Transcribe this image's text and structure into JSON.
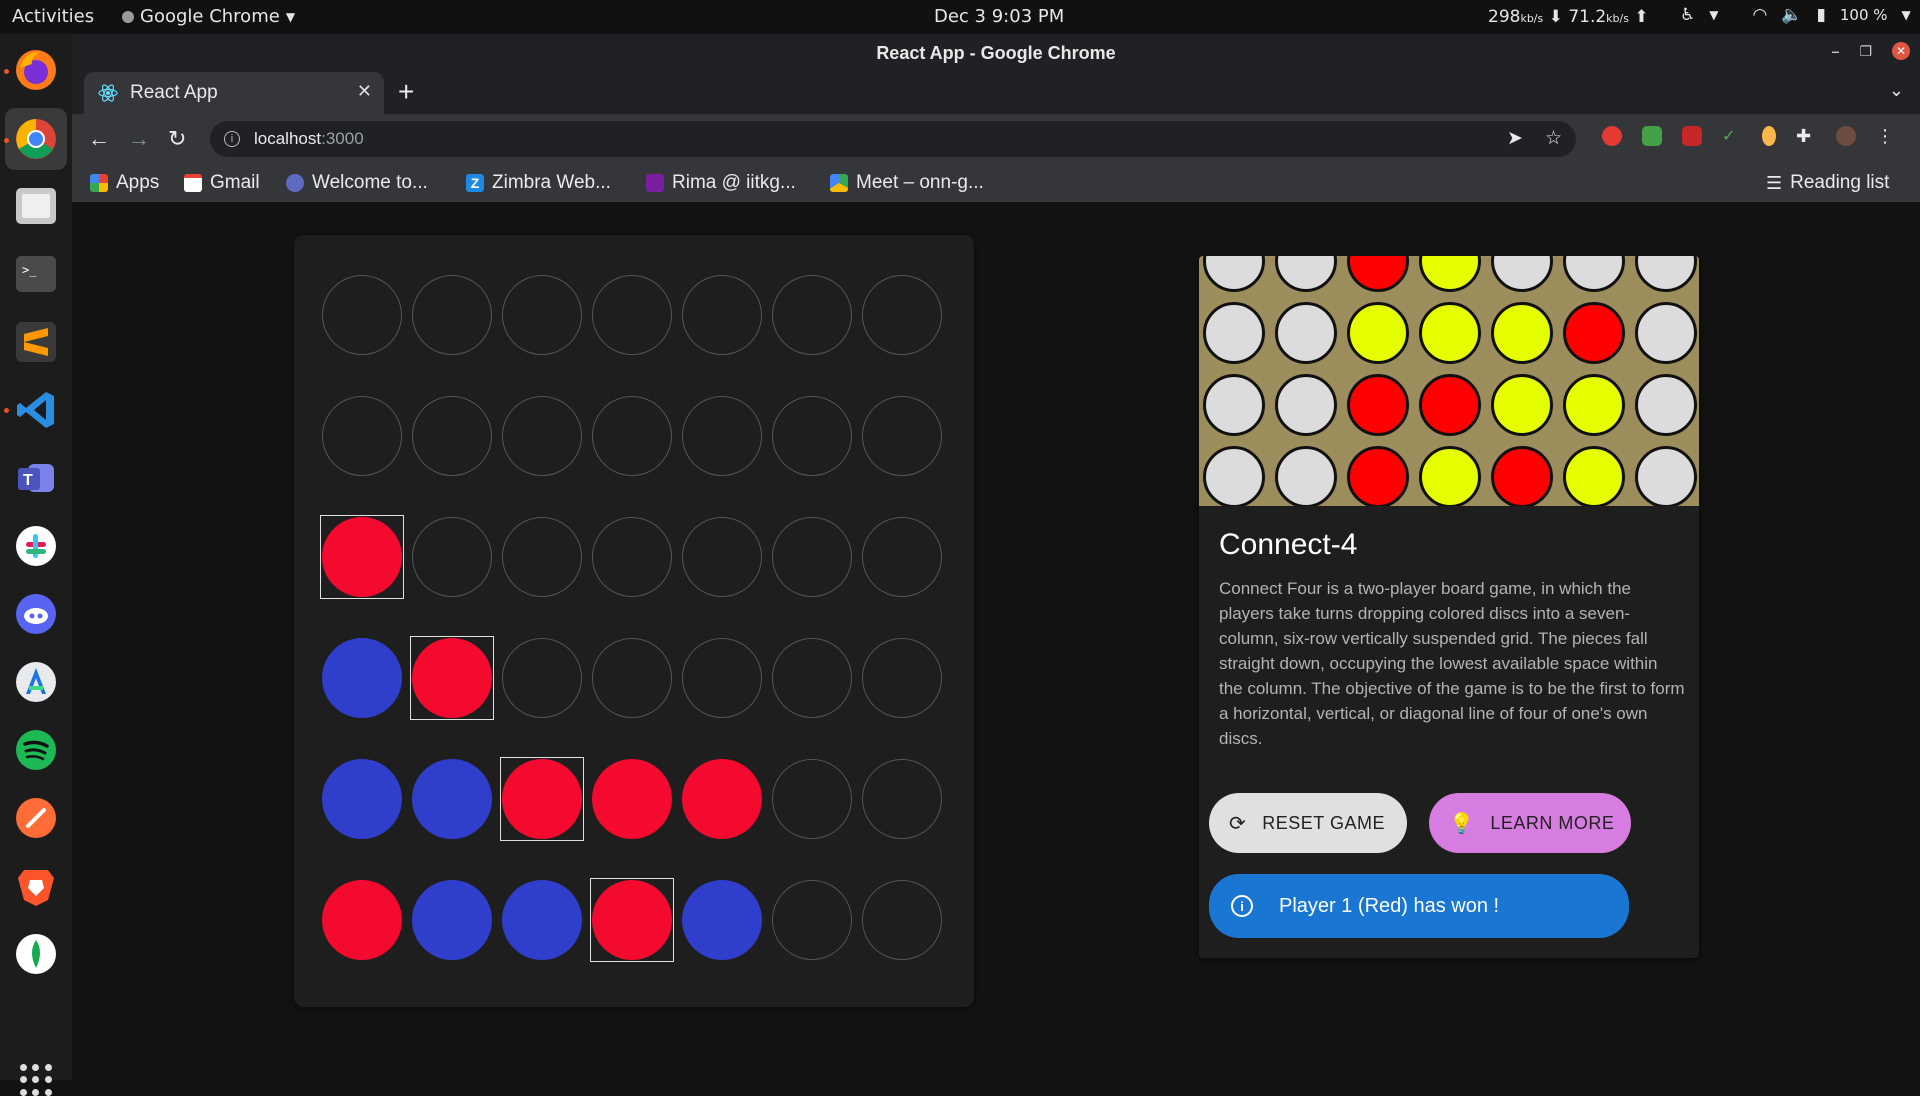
{
  "topbar": {
    "activities": "Activities",
    "app_name": "Google Chrome",
    "clock": "Dec 3  9:03 PM",
    "net_down": "298",
    "net_up": "71.2",
    "net_unit": "kb/s",
    "battery": "100 %"
  },
  "dock": {
    "items": [
      "Firefox",
      "Google Chrome",
      "Files",
      "Terminal",
      "Sublime Text",
      "Visual Studio Code",
      "Microsoft Teams",
      "Slack",
      "Discord",
      "Android Studio",
      "Spotify",
      "Postman",
      "Brave",
      "MongoDB Compass"
    ]
  },
  "window": {
    "title": "React App - Google Chrome"
  },
  "tab": {
    "title": "React App",
    "new_tab": "+"
  },
  "omnibox": {
    "host": "localhost",
    "port": ":3000"
  },
  "bookmarks": {
    "items": [
      "Apps",
      "Gmail",
      "Welcome to...",
      "Zimbra Web...",
      "Rima @ iitkg...",
      "Meet – onn-g..."
    ],
    "reading_list": "Reading list"
  },
  "board": {
    "rows": [
      [
        "empty",
        "empty",
        "empty",
        "empty",
        "empty",
        "empty",
        "empty"
      ],
      [
        "empty",
        "empty",
        "empty",
        "empty",
        "empty",
        "empty",
        "empty"
      ],
      [
        "red",
        "empty",
        "empty",
        "empty",
        "empty",
        "empty",
        "empty"
      ],
      [
        "blue",
        "red",
        "empty",
        "empty",
        "empty",
        "empty",
        "empty"
      ],
      [
        "blue",
        "blue",
        "red",
        "red",
        "red",
        "empty",
        "empty"
      ],
      [
        "red",
        "blue",
        "blue",
        "red",
        "blue",
        "empty",
        "empty"
      ]
    ],
    "winning_cells": [
      [
        2,
        0
      ],
      [
        3,
        1
      ],
      [
        4,
        2
      ],
      [
        5,
        3
      ]
    ],
    "colors": {
      "red": "#f40a2e",
      "blue": "#2f3fcc"
    }
  },
  "card": {
    "image_grid": [
      [
        "white",
        "white",
        "red",
        "yellow",
        "white",
        "white",
        "white"
      ],
      [
        "white",
        "white",
        "yellow",
        "yellow",
        "yellow",
        "red",
        "white"
      ],
      [
        "white",
        "white",
        "red",
        "red",
        "yellow",
        "yellow",
        "white"
      ],
      [
        "white",
        "white",
        "red",
        "yellow",
        "red",
        "yellow",
        "white"
      ]
    ],
    "title": "Connect-4",
    "description": "Connect Four is a two-player board game, in which the players take turns dropping colored discs into a seven-column, six-row vertically suspended grid. The pieces fall straight down, occupying the lowest available space within the column. The objective of the game is to be the first to form a horizontal, vertical, or diagonal line of four of one's own discs.",
    "reset_label": "RESET GAME",
    "learn_label": "LEARN MORE",
    "status": "Player 1 (Red) has won !"
  }
}
